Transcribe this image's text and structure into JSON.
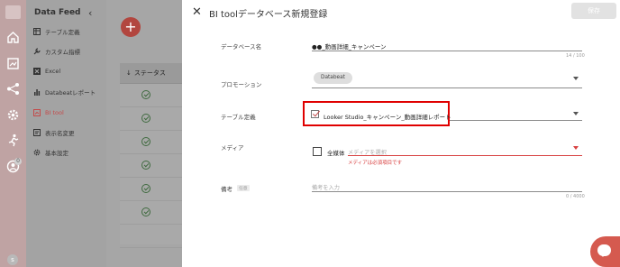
{
  "sidebar": {
    "title": "Data Feed",
    "items": [
      {
        "label": "テーブル定義",
        "icon": "table-icon"
      },
      {
        "label": "カスタム指標",
        "icon": "wrench-icon"
      },
      {
        "label": "Excel",
        "icon": "excel-icon"
      },
      {
        "label": "Databeatレポート",
        "icon": "bar-chart-icon"
      },
      {
        "label": "BI tool",
        "icon": "bi-tool-icon"
      },
      {
        "label": "表示名変更",
        "icon": "display-name-icon"
      },
      {
        "label": "基本設定",
        "icon": "gear-icon"
      }
    ],
    "active_index": 4
  },
  "rail": {
    "badge": "0",
    "avatar_initial": "s"
  },
  "list": {
    "fab_label": "+",
    "status_header": "ステータス"
  },
  "drawer": {
    "title": "BI toolデータベース新規登録",
    "save_label": "保存",
    "fields": {
      "database_name": {
        "label": "データベース名",
        "value": "●●_動画詳細_キャンペーン",
        "counter": "14 / 100"
      },
      "promotion": {
        "label": "プロモーション",
        "chip": "Databeat"
      },
      "table_definition": {
        "label": "テーブル定義",
        "value": "Looker Studio_キャンペーン_動画詳細レポート"
      },
      "media": {
        "label": "メディア",
        "all_media_label": "全媒体",
        "placeholder": "メディアを選択",
        "error": "メディアは必須項目です"
      },
      "notes": {
        "label": "備考",
        "optional_tag": "任意",
        "placeholder": "備考を入力",
        "counter": "0 / 4000"
      }
    }
  },
  "colors": {
    "accent": "#c44a4a",
    "highlight": "#e00000",
    "error": "#d84141",
    "chat": "#d55a4f",
    "check": "#3f6a3f"
  }
}
